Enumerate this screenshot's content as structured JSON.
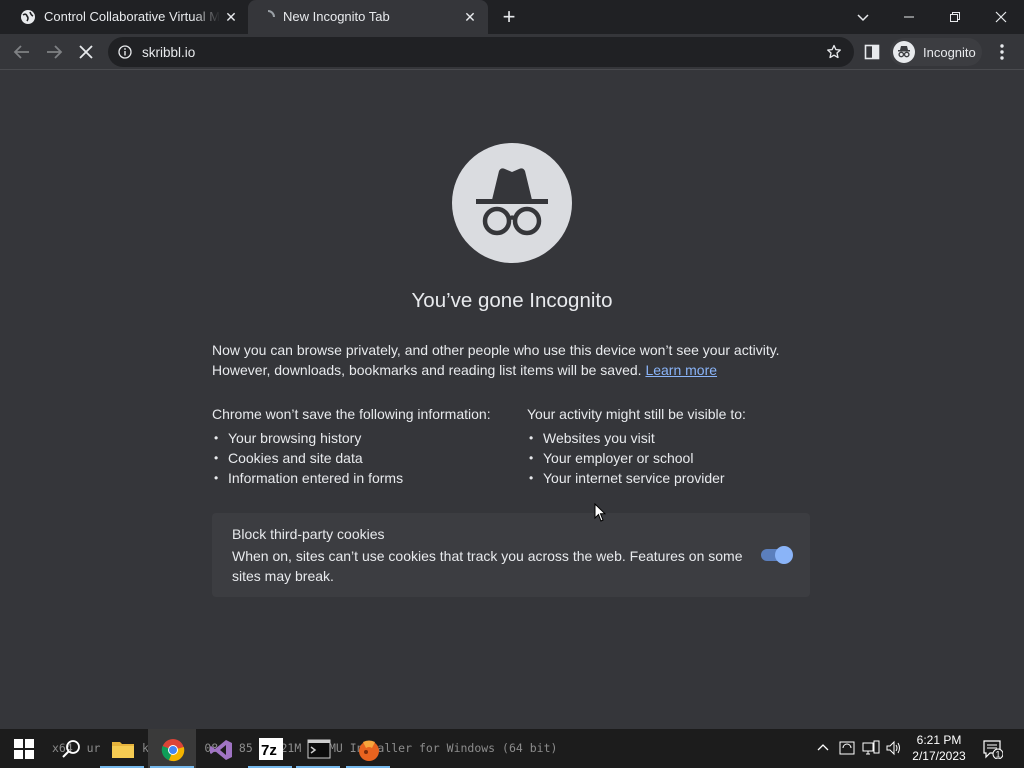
{
  "tabs": [
    {
      "title": "Control Collaborative Virtual Mac",
      "state": "inactive",
      "favicon": "globe-icon"
    },
    {
      "title": "New Incognito Tab",
      "state": "active-loading",
      "favicon": "spinner-icon"
    }
  ],
  "toolbar": {
    "url": "skribbl.io",
    "profile_label": "Incognito"
  },
  "page": {
    "heading": "You’ve gone Incognito",
    "intro_text": "Now you can browse privately, and other people who use this device won’t see your activity. However, downloads, bookmarks and reading list items will be saved.",
    "learn_more": "Learn more",
    "left_column": {
      "head": "Chrome won’t save the following information:",
      "items": [
        "Your browsing history",
        "Cookies and site data",
        "Information entered in forms"
      ]
    },
    "right_column": {
      "head": "Your activity might still be visible to:",
      "items": [
        "Websites you visit",
        "Your employer or school",
        "Your internet service provider"
      ]
    },
    "cookie_card": {
      "title": "Block third-party cookies",
      "description": "When on, sites can’t use cookies that track you across the web. Features on some sites may break.",
      "toggle_on": true
    }
  },
  "taskbar": {
    "background_text": "x64  ur  Bu  ke  619  08   85   121M  QEMU Installer for Windows (64 bit)",
    "apps": [
      "file-explorer-icon",
      "chrome-icon",
      "visual-studio-icon",
      "7zip-icon",
      "terminal-icon",
      "orange-app-icon"
    ],
    "time": "6:21 PM",
    "date": "2/17/2023",
    "notification_count": "1"
  },
  "colors": {
    "background": "#35363a",
    "tabstrip": "#202124",
    "text": "#e8eaed",
    "link": "#8ab4f8",
    "card": "#3c3d41",
    "taskbar": "#1c1c1c"
  }
}
